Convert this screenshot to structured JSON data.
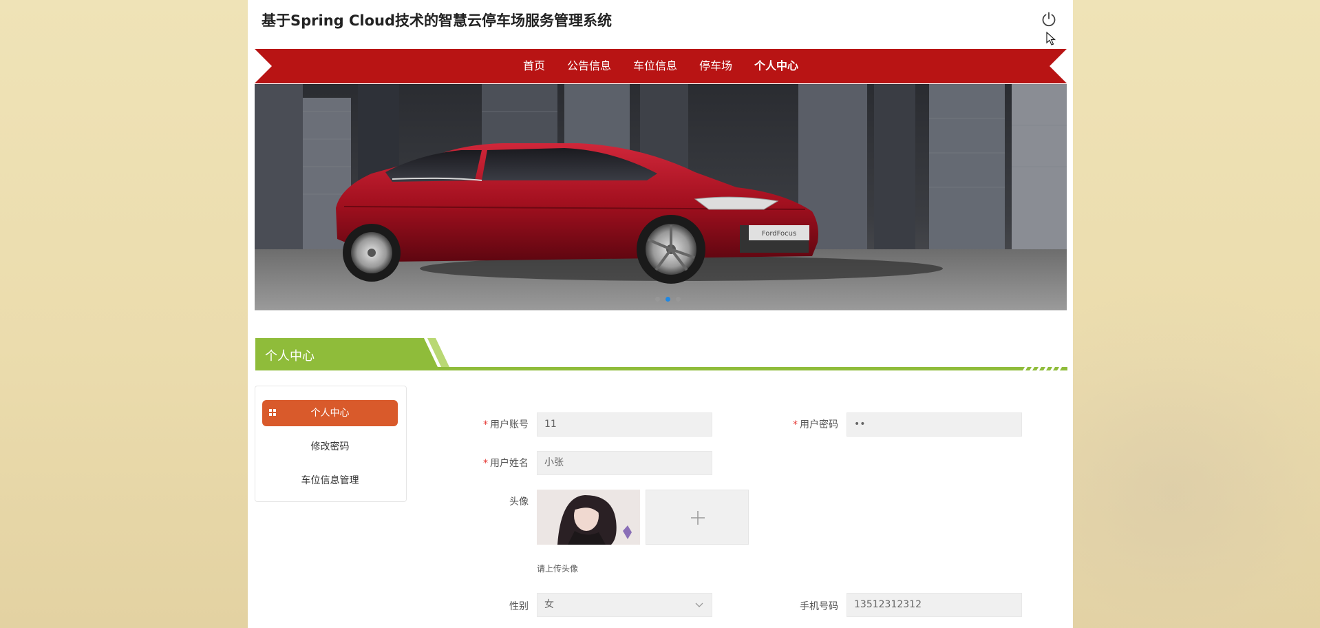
{
  "header": {
    "site_title": "基于Spring Cloud技术的智慧云停车场服务管理系统",
    "power_icon": "power-icon"
  },
  "nav": {
    "items": [
      {
        "label": "首页"
      },
      {
        "label": "公告信息"
      },
      {
        "label": "车位信息"
      },
      {
        "label": "停车场"
      },
      {
        "label": "个人中心",
        "active": true
      }
    ],
    "color": "#b81414"
  },
  "banner": {
    "plate_text": "FordFocus",
    "slide_count": 3,
    "active_slide": 2
  },
  "section": {
    "title": "个人中心",
    "accent_color": "#8fbc3a"
  },
  "side_menu": {
    "items": [
      {
        "label": "个人中心",
        "active": true
      },
      {
        "label": "修改密码"
      },
      {
        "label": "车位信息管理"
      }
    ],
    "active_color": "#d95a2b"
  },
  "form": {
    "account": {
      "label": "用户账号",
      "value": "11",
      "required": true
    },
    "password": {
      "label": "用户密码",
      "value": "••",
      "required": true
    },
    "name": {
      "label": "用户姓名",
      "value": "小张",
      "required": true
    },
    "avatar": {
      "label": "头像",
      "hint": "请上传头像"
    },
    "gender": {
      "label": "性别",
      "value": "女"
    },
    "phone": {
      "label": "手机号码",
      "value": "13512312312"
    }
  }
}
